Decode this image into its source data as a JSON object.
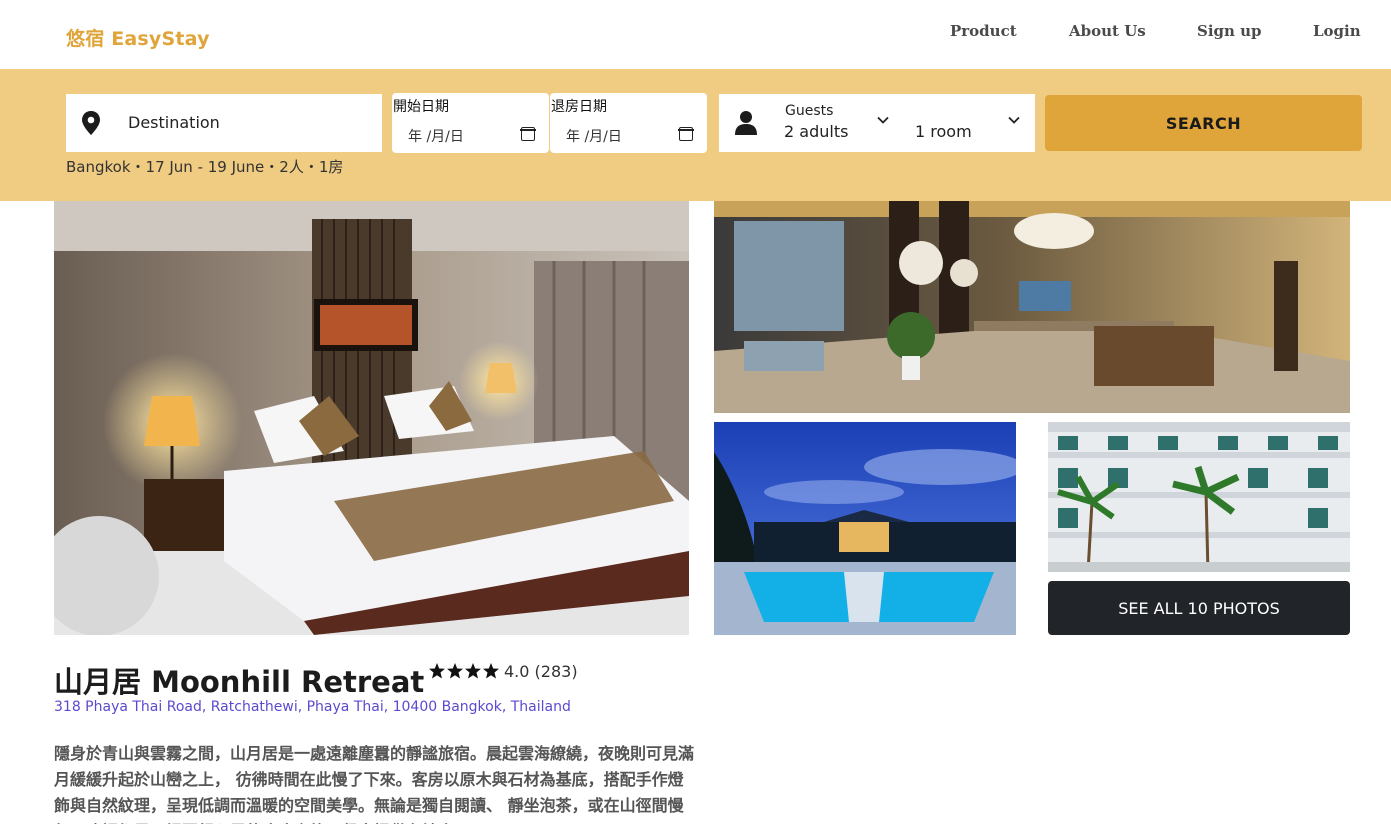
{
  "header": {
    "logo": "悠宿 EasyStay",
    "nav": {
      "product": "Product",
      "about": "About Us",
      "signup": "Sign up",
      "login": "Login"
    }
  },
  "search": {
    "destination_label": "Destination",
    "start_caption": "開始日期",
    "start_value": "年 /月/日",
    "end_caption": "退房日期",
    "end_value": "年 /月/日",
    "guests_caption": "Guests",
    "guests_value": "2 adults",
    "rooms_value": "1 room",
    "button_label": "SEARCH",
    "summary": "Bangkok・17 Jun - 19 June・2人・1房"
  },
  "gallery": {
    "see_all_label": "SEE ALL 10 PHOTOS"
  },
  "hotel": {
    "name": "山月居 Moonhill Retreat",
    "stars": 4,
    "rating": "4.0 (283)",
    "address": "318 Phaya Thai Road, Ratchathewi, Phaya Thai, 10400 Bangkok, Thailand",
    "description": "隱身於青山與雲霧之間，山月居是一處遠離塵囂的靜謐旅宿。晨起雲海繚繞，夜晚則可見滿月緩緩升起於山巒之上， 彷彿時間在此慢了下來。客房以原木與石材為基底，搭配手作燈飾與自然紋理，呈現低調而溫暖的空間美學。無論是獨自閱讀、 靜坐泡茶，或在山徑間慢行，這裡都是一場回歸心靈的療癒之旅。餐廳提供在地食"
  },
  "colors": {
    "accent": "#e0a53a",
    "band": "#f0cc82",
    "dark_button": "#212529",
    "address": "#5b4ad0"
  },
  "icons": [
    "map-pin-icon",
    "calendar-icon",
    "person-icon",
    "chevron-down-icon",
    "star-icon"
  ]
}
